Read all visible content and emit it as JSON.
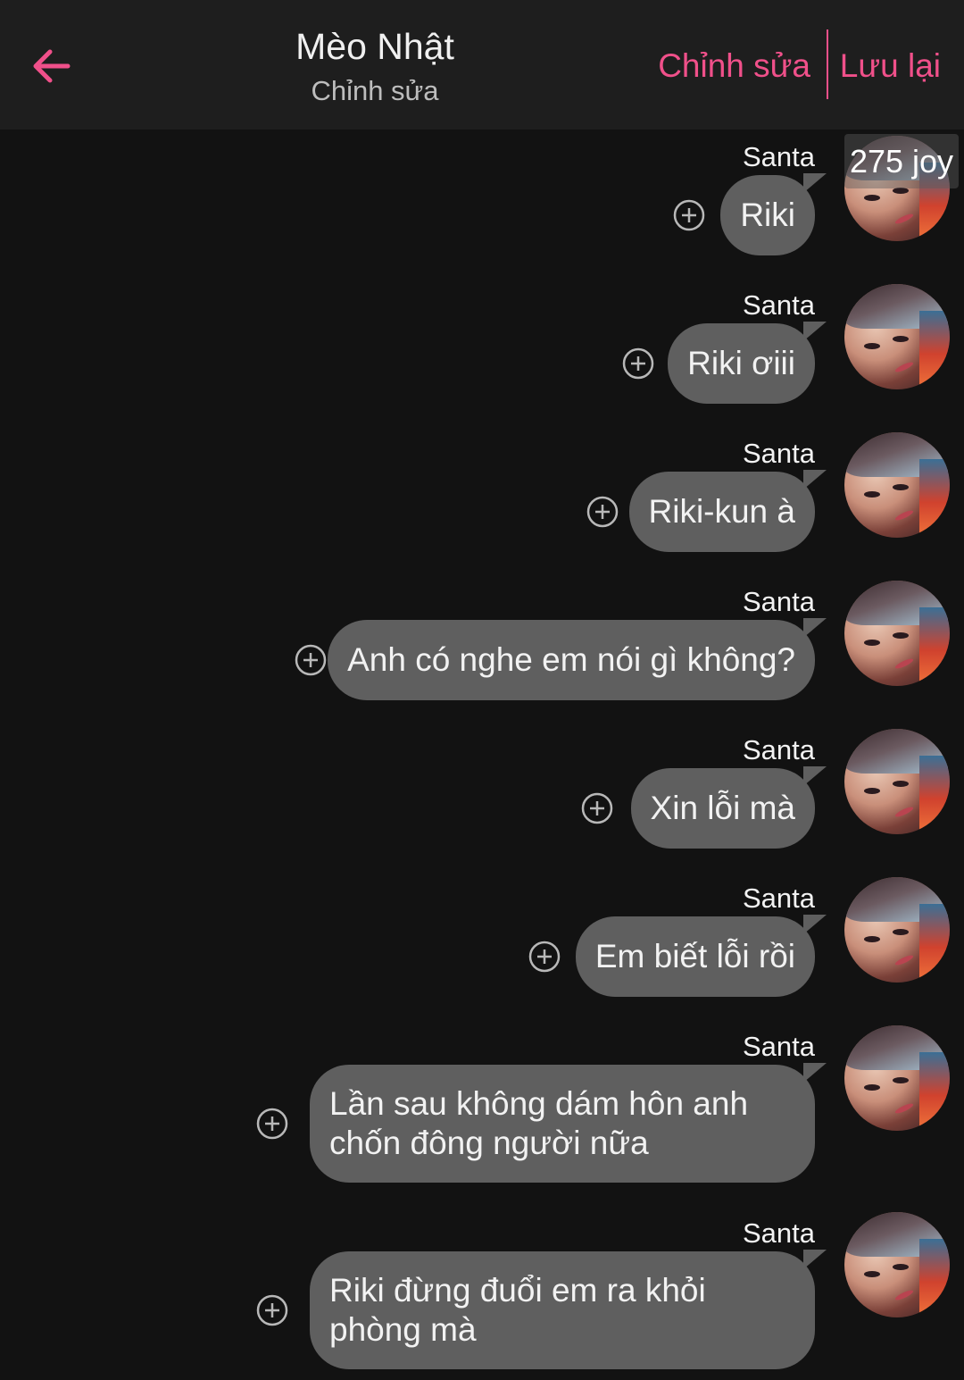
{
  "header": {
    "back_icon": "arrow-left-icon",
    "title": "Mèo Nhật",
    "subtitle": "Chỉnh sửa",
    "edit_label": "Chỉnh sửa",
    "save_label": "Lưu lại",
    "accent_color": "#f0508a"
  },
  "badge": {
    "label": "275 joy"
  },
  "messages": [
    {
      "sender": "Santa",
      "text": "Riki"
    },
    {
      "sender": "Santa",
      "text": "Riki ơiii"
    },
    {
      "sender": "Santa",
      "text": "Riki-kun à"
    },
    {
      "sender": "Santa",
      "text": "Anh có nghe em nói gì không?"
    },
    {
      "sender": "Santa",
      "text": "Xin lỗi mà"
    },
    {
      "sender": "Santa",
      "text": "Em biết lỗi rồi"
    },
    {
      "sender": "Santa",
      "text": "Lần sau không dám hôn anh chốn đông người nữa"
    },
    {
      "sender": "Santa",
      "text": "Riki đừng đuổi em ra khỏi phòng mà"
    }
  ],
  "colors": {
    "background": "#121212",
    "header": "#1e1e1e",
    "bubble": "#5f5f5f"
  }
}
